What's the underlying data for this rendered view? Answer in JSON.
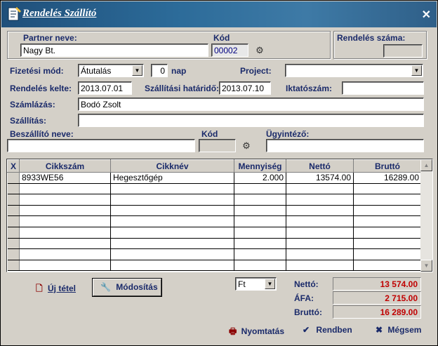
{
  "window": {
    "title": "Rendelés Szállító"
  },
  "partner": {
    "name_label": "Partner neve:",
    "name_value": "Nagy Bt.",
    "code_label": "Kód",
    "code_value": "00002"
  },
  "order": {
    "number_label": "Rendelés száma:",
    "number_value": ""
  },
  "payment": {
    "label": "Fizetési mód:",
    "value": "Átutalás",
    "days_value": "0",
    "days_unit": "nap"
  },
  "project": {
    "label": "Project:",
    "value": ""
  },
  "dates": {
    "order_date_label": "Rendelés kelte:",
    "order_date_value": "2013.07.01",
    "delivery_label": "Szállítási határidő:",
    "delivery_value": "2013.07.10"
  },
  "filing": {
    "label": "Iktatószám:",
    "value": ""
  },
  "billing": {
    "label": "Számlázás:",
    "value": "Bodó Zsolt"
  },
  "shipping": {
    "label": "Szállítás:",
    "value": ""
  },
  "supplier": {
    "name_label": "Beszállító neve:",
    "name_value": "",
    "code_label": "Kód",
    "code_value": ""
  },
  "agent": {
    "label": "Ügyintéző:",
    "value": ""
  },
  "items": {
    "headers": [
      "X",
      "Cikkszám",
      "Cikknév",
      "Mennyiség",
      "Nettó",
      "Bruttó"
    ],
    "rows": [
      {
        "code": "8933WE56",
        "name": "Hegesztőgép",
        "qty": "2.000",
        "net": "13574.00",
        "gross": "16289.00"
      }
    ],
    "empty_rows": 8
  },
  "actions": {
    "new_item": "Új tétel",
    "modify": "Módosítás",
    "print": "Nyomtatás",
    "ok": "Rendben",
    "cancel": "Mégsem"
  },
  "currency": {
    "value": "Ft"
  },
  "totals": {
    "net_label": "Nettó:",
    "net_value": "13 574.00",
    "vat_label": "ÁFA:",
    "vat_value": "2 715.00",
    "gross_label": "Bruttó:",
    "gross_value": "16 289.00"
  },
  "colors": {
    "title_bar": "#2c6b99",
    "label_text": "#1a2a6a",
    "total_text": "#c00000",
    "face": "#d4d0c8"
  }
}
